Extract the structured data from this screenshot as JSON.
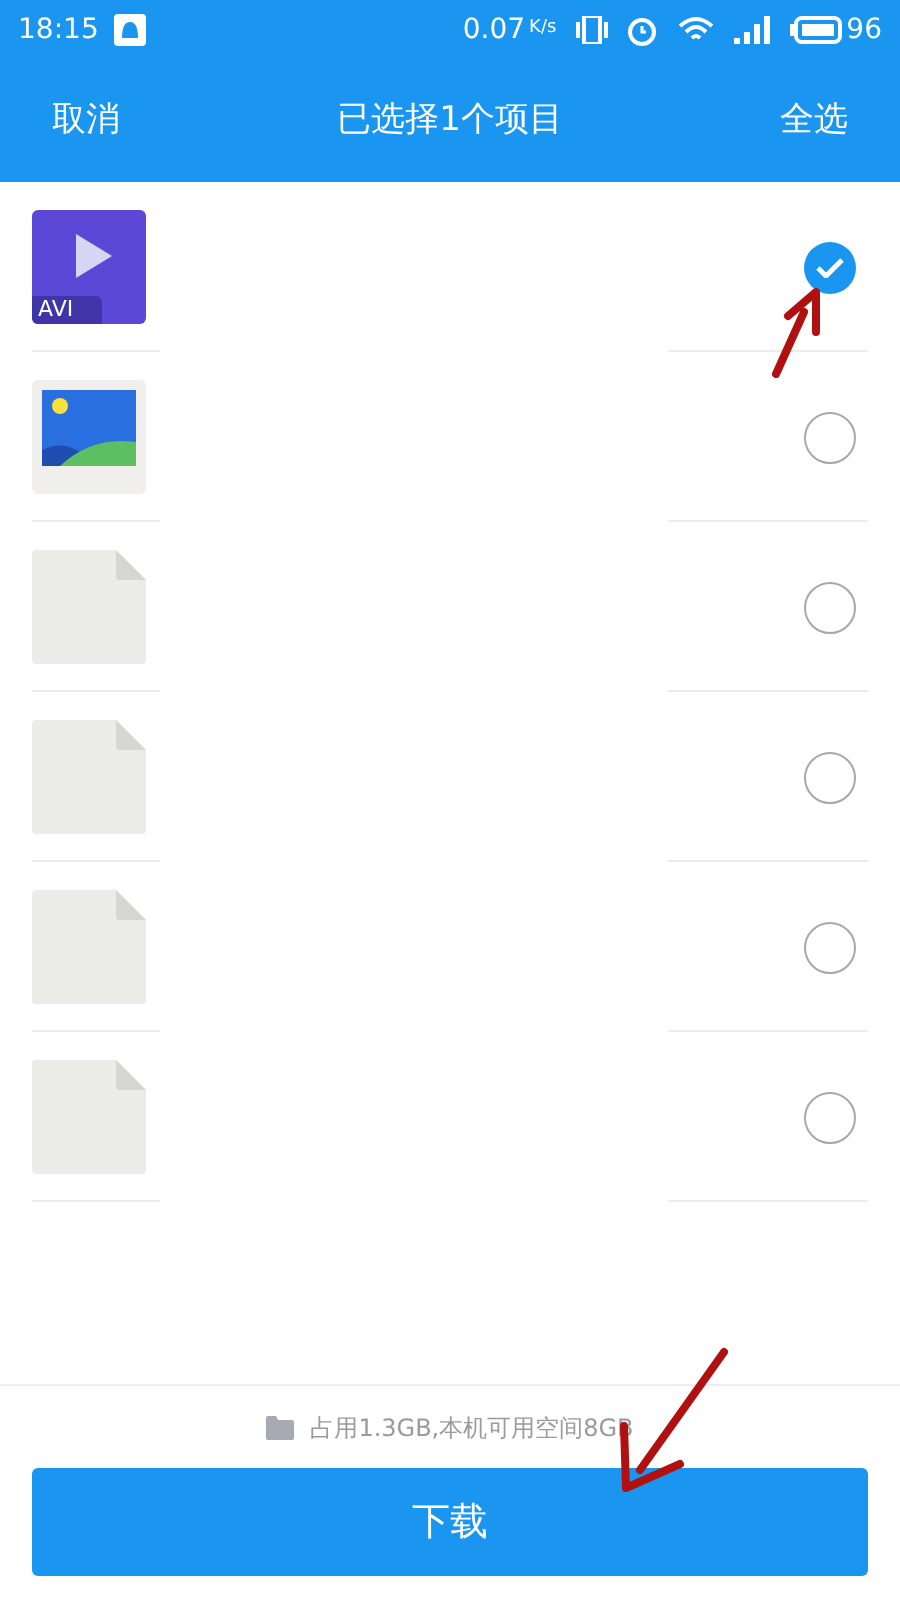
{
  "status_bar": {
    "time": "18:15",
    "speed": "0.07",
    "speed_unit": "K/s",
    "battery": "96"
  },
  "header": {
    "cancel": "取消",
    "title": "已选择1个项目",
    "select_all": "全选"
  },
  "files": [
    {
      "kind": "video",
      "badge": "AVI",
      "selected": true
    },
    {
      "kind": "image",
      "selected": false
    },
    {
      "kind": "blank",
      "selected": false
    },
    {
      "kind": "blank",
      "selected": false
    },
    {
      "kind": "blank",
      "selected": false
    },
    {
      "kind": "blank",
      "selected": false
    }
  ],
  "storage": "占用1.3GB,本机可用空间8GB",
  "download": "下载"
}
